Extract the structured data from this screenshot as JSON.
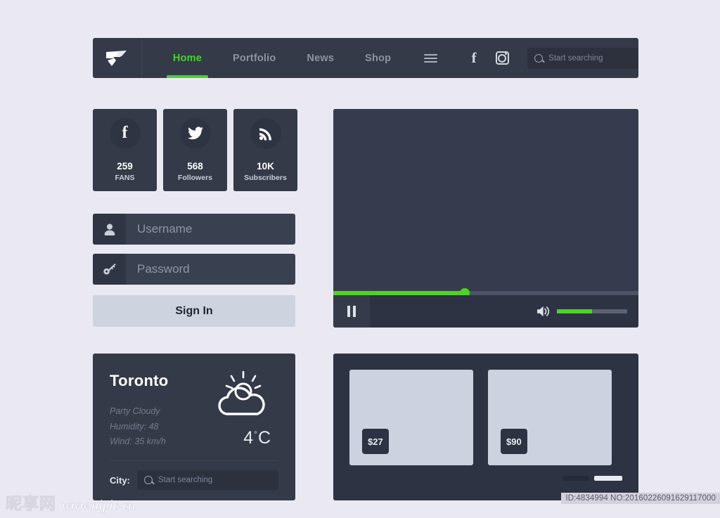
{
  "navbar": {
    "logo_icon": "brand-logo-icon",
    "links": [
      {
        "label": "Home",
        "active": true
      },
      {
        "label": "Portfolio",
        "active": false
      },
      {
        "label": "News",
        "active": false
      },
      {
        "label": "Shop",
        "active": false
      }
    ],
    "icons": [
      "hamburger-menu-icon",
      "facebook-icon",
      "instagram-icon"
    ],
    "search": {
      "placeholder": "Start searching",
      "value": ""
    },
    "accent_color": "#45d52b",
    "bar_color": "#343a48"
  },
  "stats": [
    {
      "icon": "facebook-icon",
      "count": "259",
      "label": "FANS"
    },
    {
      "icon": "twitter-icon",
      "count": "568",
      "label": "Followers"
    },
    {
      "icon": "rss-icon",
      "count": "10K",
      "label": "Subscribers"
    }
  ],
  "login": {
    "username": {
      "placeholder": "Username",
      "value": "",
      "icon": "user-icon"
    },
    "password": {
      "placeholder": "Password",
      "value": "",
      "icon": "key-icon"
    },
    "submit_label": "Sign In"
  },
  "weather": {
    "city": "Toronto",
    "condition": "Party Cloudy",
    "humidity": "Humidity: 48",
    "wind": "Wind: 35 km/h",
    "temperature": "4",
    "degree_symbol": "°",
    "unit": "C",
    "icon": "sun-behind-cloud-icon",
    "city_label": "City:",
    "search": {
      "placeholder": "Start searching",
      "value": ""
    }
  },
  "video": {
    "progress_percent": 43,
    "volume_percent": 50,
    "play_state": "paused",
    "play_icon": "pause-icon",
    "volume_icon": "speaker-icon",
    "progress_color": "#4ed422"
  },
  "products": {
    "items": [
      {
        "price": "$27"
      },
      {
        "price": "$90"
      }
    ],
    "pager": [
      {
        "active": false
      },
      {
        "active": true
      }
    ]
  },
  "watermark": {
    "brand_cn": "昵享网",
    "url": "www.nipic.cn",
    "id_text": "ID:4834994 NO:20160226091629117000"
  }
}
